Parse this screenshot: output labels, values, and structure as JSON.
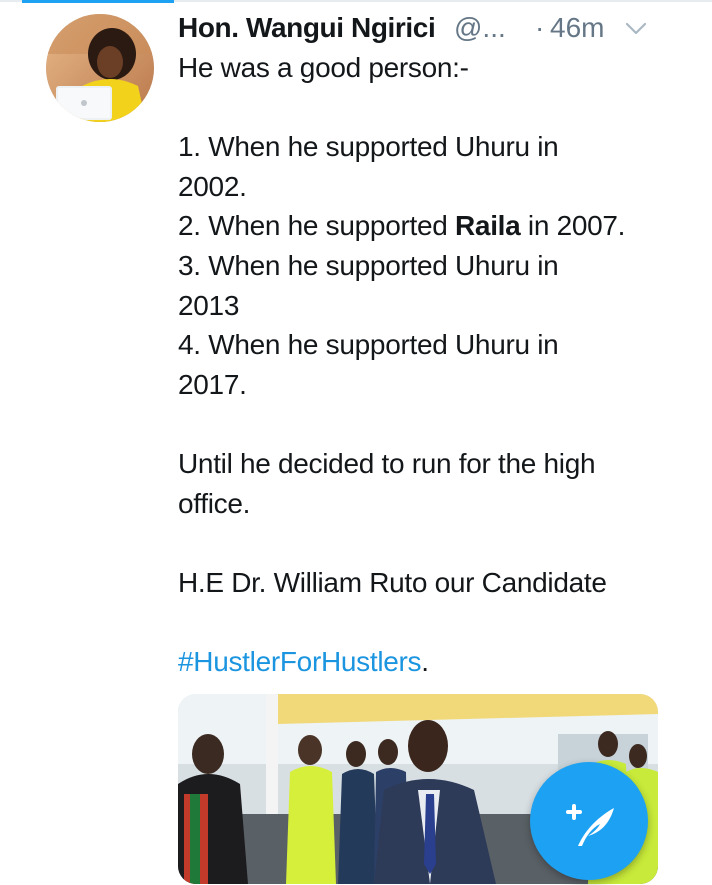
{
  "tweet": {
    "author_name": "Hon. Wangui Ngirici",
    "handle": "@...",
    "separator": "·",
    "time": "46m",
    "lines": [
      {
        "text": "He was a good person:-"
      },
      {
        "gap": true
      },
      {
        "text": "1. When he supported Uhuru in"
      },
      {
        "text": "2002."
      },
      {
        "before": "2. When he supported ",
        "bold": "Raila",
        "after": " in 2007."
      },
      {
        "text": "3. When he supported Uhuru in"
      },
      {
        "text": "2013"
      },
      {
        "text": "4. When he supported Uhuru in"
      },
      {
        "text": "2017."
      },
      {
        "gap": true
      },
      {
        "text": "Until he decided to run for the high"
      },
      {
        "text": "office."
      },
      {
        "gap": true
      },
      {
        "text": "H.E Dr.  William Ruto  our Candidate"
      },
      {
        "gap": true
      },
      {
        "hashtag": "#HustlerForHustlers",
        "after": "."
      }
    ]
  },
  "icons": {
    "more": "chevron-down-icon",
    "compose": "compose-tweet-icon"
  },
  "colors": {
    "accent": "#1da1f2",
    "hashtag": "#1b95e0",
    "secondary_text": "#657786",
    "text": "#14171a"
  }
}
